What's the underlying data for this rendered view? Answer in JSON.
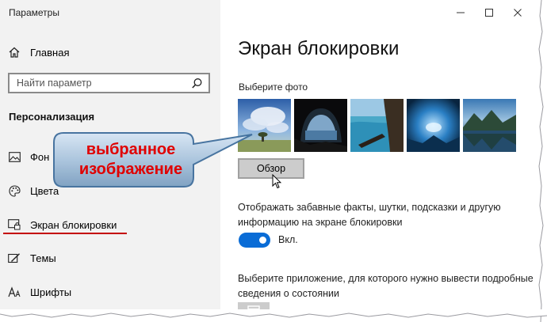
{
  "window": {
    "title": "Параметры"
  },
  "sidebar": {
    "home_label": "Главная",
    "search_placeholder": "Найти параметр",
    "section_heading": "Персонализация",
    "items": [
      {
        "label": "Фон",
        "icon": "picture-icon"
      },
      {
        "label": "Цвета",
        "icon": "palette-icon"
      },
      {
        "label": "Экран блокировки",
        "icon": "lock-screen-icon",
        "active": true
      },
      {
        "label": "Темы",
        "icon": "themes-icon"
      },
      {
        "label": "Шрифты",
        "icon": "fonts-icon"
      }
    ]
  },
  "main": {
    "title": "Экран блокировки",
    "choose_photo_label": "Выберите фото",
    "browse_label": "Обзор",
    "facts_text": "Отображать забавные факты, шутки, подсказки и другую информацию на экране блокировки",
    "toggle_state": "Вкл.",
    "app_select_text": "Выберите приложение, для которого нужно вывести подробные сведения о состоянии"
  },
  "annotation": {
    "line1": "выбранное",
    "line2": "изображение"
  },
  "colors": {
    "accent": "#0a6cd6",
    "annotation_text": "#e00000",
    "underline": "#c40000",
    "sidebar_bg": "#f2f2f2"
  }
}
